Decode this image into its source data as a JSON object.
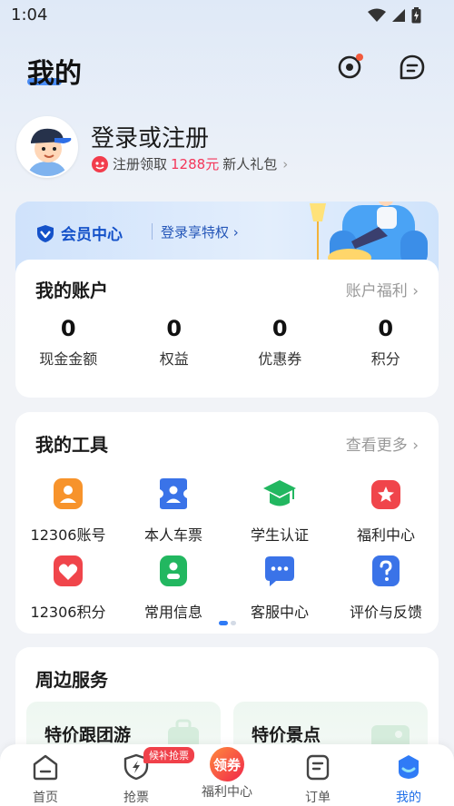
{
  "status_bar": {
    "time": "1:04"
  },
  "header": {
    "title": "我的"
  },
  "profile": {
    "login_text": "登录或注册",
    "promo_prefix": "注册领取",
    "promo_amount": "1288元",
    "promo_suffix": "新人礼包",
    "promo_arrow": "›"
  },
  "member": {
    "title": "会员中心",
    "link": "登录享特权 ›"
  },
  "account": {
    "title": "我的账户",
    "more": "账户福利 ›",
    "items": [
      {
        "value": "0",
        "label": "现金金额"
      },
      {
        "value": "0",
        "label": "权益"
      },
      {
        "value": "0",
        "label": "优惠券"
      },
      {
        "value": "0",
        "label": "积分"
      }
    ]
  },
  "tools": {
    "title": "我的工具",
    "more": "查看更多 ›",
    "items": [
      {
        "label": "12306账号",
        "icon": "account-id-icon",
        "color": "#f7932b"
      },
      {
        "label": "本人车票",
        "icon": "ticket-icon",
        "color": "#3a73e8"
      },
      {
        "label": "学生认证",
        "icon": "graduation-cap-icon",
        "color": "#22b760"
      },
      {
        "label": "福利中心",
        "icon": "gift-star-icon",
        "color": "#f0454b"
      },
      {
        "label": "12306积分",
        "icon": "heart-points-icon",
        "color": "#f0454b"
      },
      {
        "label": "常用信息",
        "icon": "contact-info-icon",
        "color": "#22b760"
      },
      {
        "label": "客服中心",
        "icon": "chat-service-icon",
        "color": "#3a73e8"
      },
      {
        "label": "评价与反馈",
        "icon": "question-feedback-icon",
        "color": "#3a73e8"
      }
    ]
  },
  "nearby": {
    "title": "周边服务",
    "tiles": [
      {
        "label": "特价跟团游"
      },
      {
        "label": "特价景点"
      }
    ]
  },
  "tab_bar": {
    "active_color": "#1f6fe8",
    "badge": "候补抢票",
    "promo_icon_text": "领券",
    "items": [
      {
        "label": "首页",
        "icon": "home-icon"
      },
      {
        "label": "抢票",
        "icon": "grab-ticket-icon"
      },
      {
        "label": "福利中心",
        "icon": "coupon-promo-icon"
      },
      {
        "label": "订单",
        "icon": "order-icon"
      },
      {
        "label": "我的",
        "icon": "profile-icon"
      }
    ]
  }
}
